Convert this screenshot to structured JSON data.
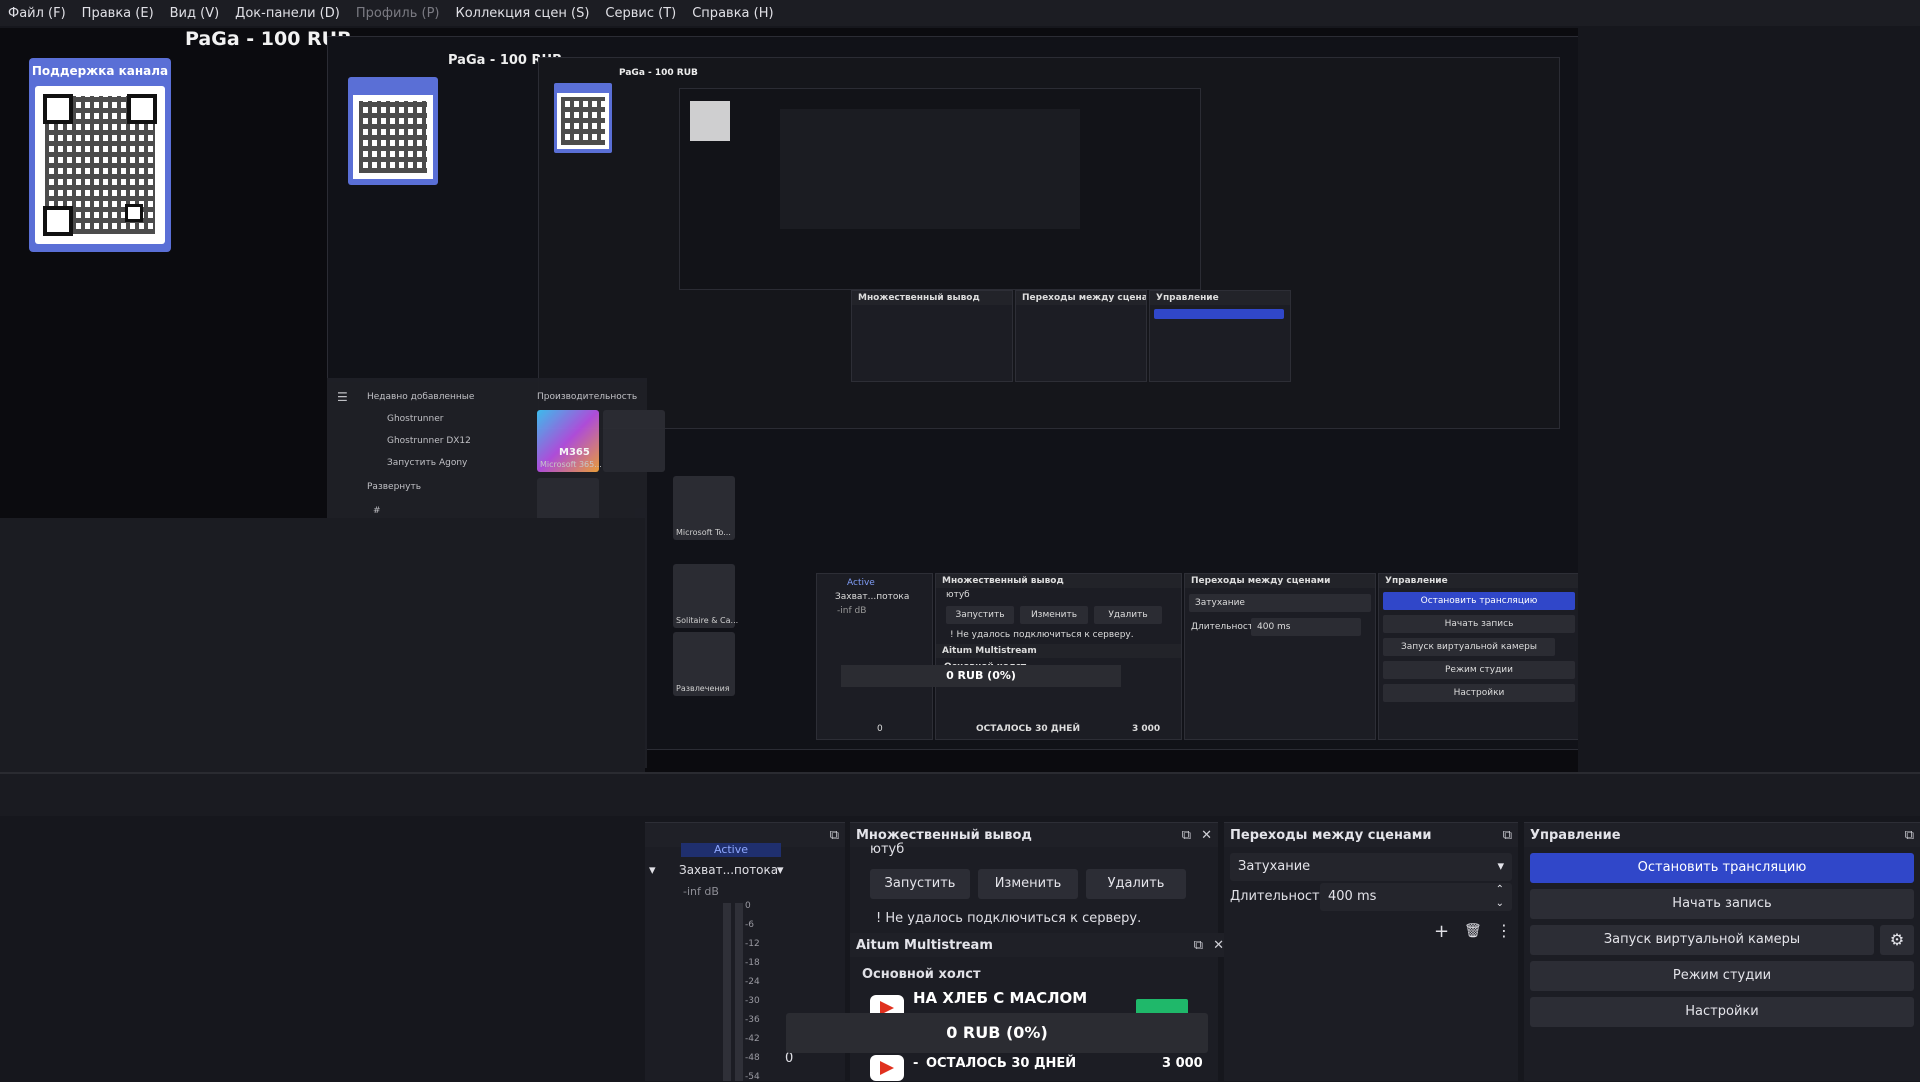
{
  "menu": [
    "Файл (F)",
    "Правка (E)",
    "Вид (V)",
    "Док-панели (D)",
    "Профиль (P)",
    "Коллекция сцен (S)",
    "Сервис (T)",
    "Справка (H)"
  ],
  "preview": {
    "title": "PaGa - 100 RUB",
    "qr_card_title": "Поддержка канала"
  },
  "start_menu": {
    "recent_header": "Недавно добавленные",
    "productivity_header": "Производительность",
    "apps": [
      "Ghostrunner",
      "Ghostrunner DX12",
      "Запустить Agony"
    ],
    "expand": "Развернуть",
    "hash": "#",
    "tiles": [
      "M365",
      "Microsoft 365...",
      "Microsoft To...",
      "Solitaire & Ca...",
      "Развлечения"
    ]
  },
  "mixer": {
    "active_label": "Active",
    "source_name": "Захват...потока",
    "db": "-inf dB",
    "db_ticks": [
      "0",
      "-6",
      "-12",
      "-18",
      "-24",
      "-30",
      "-36",
      "-42",
      "-48",
      "-54"
    ],
    "volume": "0",
    "level_fraction": 0.0
  },
  "multi_output": {
    "title": "Множественный вывод",
    "target": "ютуб",
    "start": "Запустить",
    "edit": "Изменить",
    "delete": "Удалить",
    "error": "! Не удалось подключиться к серверу."
  },
  "aitum": {
    "title": "Aitum Multistream",
    "canvas": "Основной холст",
    "goal1": "НА ХЛЕБ С МАСЛОМ",
    "progress": "0 RUB (0%)",
    "goal2": "ОСТАЛОСЬ 30 ДНЕЙ",
    "goal2_amount": "3 000",
    "goal2_prefix": "-"
  },
  "transitions": {
    "title": "Переходы между сценами",
    "selected": "Затухание",
    "duration_label": "Длительность",
    "duration_value": "400 ms"
  },
  "controls": {
    "title": "Управление",
    "stop_stream": "Остановить трансляцию",
    "start_record": "Начать запись",
    "virtual_cam": "Запуск виртуальной камеры",
    "studio_mode": "Режим студии",
    "settings": "Настройки"
  },
  "colors": {
    "accent": "#3047c9",
    "qr_card": "#5a6fd6",
    "green": "#1fb86a"
  }
}
